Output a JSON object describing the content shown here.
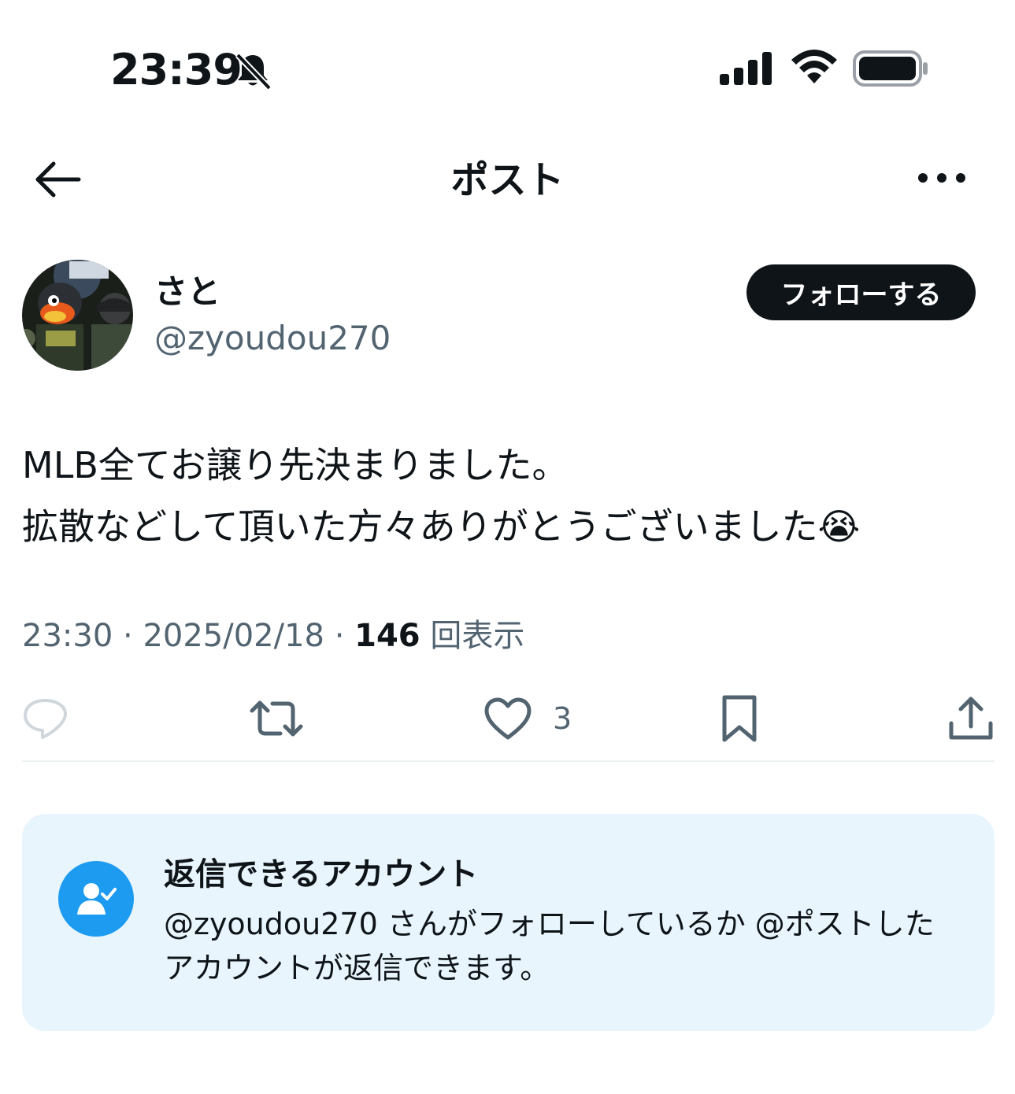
{
  "status_bar": {
    "time": "23:39",
    "icons": [
      "bell-slash-icon",
      "cellular-signal-icon",
      "wifi-icon",
      "battery-icon"
    ]
  },
  "nav": {
    "title": "ポスト",
    "back_icon": "arrow-left-icon",
    "more_icon": "more-horizontal-icon"
  },
  "author": {
    "display_name": "さと",
    "handle": "@zyoudou270",
    "follow_label": "フォローする"
  },
  "post": {
    "line1": "MLB全てお譲り先決まりました。",
    "line2": "拡散などして頂いた方々ありがとうございました",
    "emoji": "😭"
  },
  "meta": {
    "time": "23:30",
    "separator": "·",
    "date": "2025/02/18",
    "views_count": "146",
    "views_label": "回表示"
  },
  "actions": {
    "reply_icon": "reply-icon",
    "repost_icon": "repost-icon",
    "like_icon": "heart-icon",
    "like_count": "3",
    "bookmark_icon": "bookmark-icon",
    "share_icon": "share-icon"
  },
  "reply_info": {
    "title": "返信できるアカウント",
    "description": "@zyoudou270 さんがフォローしているか @ポストしたアカウントが返信できます。",
    "icon": "user-check-icon"
  },
  "colors": {
    "text_primary": "#0f1419",
    "text_secondary": "#536471",
    "accent": "#1d9bf0",
    "card_bg": "#e8f5fd"
  }
}
